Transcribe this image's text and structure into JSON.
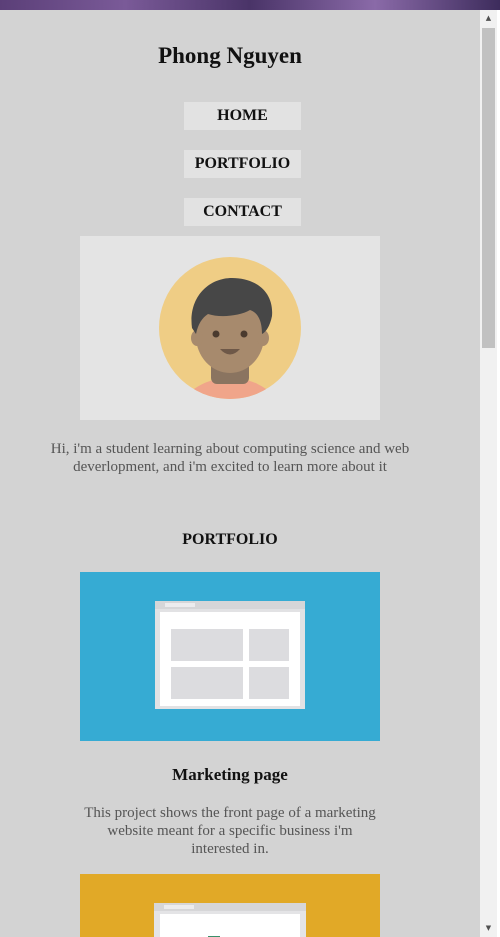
{
  "header": {
    "title": "Phong Nguyen"
  },
  "nav": {
    "items": [
      {
        "label": "HOME"
      },
      {
        "label": "PORTFOLIO"
      },
      {
        "label": "CONTACT"
      }
    ]
  },
  "intro": {
    "text": "Hi, i'm a student learning about computing science and web deverlopment, and i'm excited to learn more about it"
  },
  "portfolio": {
    "heading": "PORTFOLIO",
    "projects": [
      {
        "title": "Marketing page",
        "description": "This project shows the front page of a marketing website meant for a specific business i'm interested in.",
        "thumb_color": "#36abd3"
      },
      {
        "title": "",
        "description": "",
        "thumb_color": "#e1a927"
      }
    ]
  },
  "colors": {
    "page_bg": "#d3d3d3",
    "nav_bg": "#e2e2e2",
    "avatar_ring": "#efcd85",
    "avatar_hair": "#474747",
    "avatar_skin": "#a78a6d",
    "avatar_shirt": "#f0a58a"
  },
  "icons": {
    "avatar": "avatar-illustration",
    "wireframe": "webpage-wireframe-icon"
  }
}
